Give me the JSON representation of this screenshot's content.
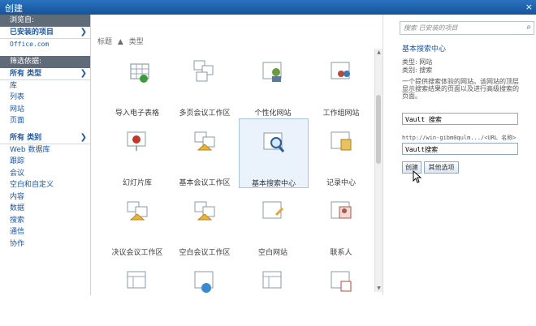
{
  "window": {
    "title": "创建",
    "close_glyph": "×"
  },
  "left": {
    "browse_header": "浏览自:",
    "installed_items": "已安装的项目",
    "office_com": "Office.com",
    "filter_header": "筛选依据:",
    "all_types": "所有 类型",
    "types": [
      "库",
      "列表",
      "网站",
      "页面"
    ],
    "all_categories": "所有 类别",
    "categories": [
      "Web 数据库",
      "跟踪",
      "会议",
      "空白和自定义",
      "内容",
      "数据",
      "搜索",
      "通信",
      "协作"
    ]
  },
  "main": {
    "sort_title": "标题",
    "sort_arrow": "▲",
    "sort_type": "类型",
    "tiles": [
      {
        "label": "导入电子表格",
        "icon": "spreadsheet-import-icon"
      },
      {
        "label": "多页会议工作区",
        "icon": "multipage-meeting-icon"
      },
      {
        "label": "个性化网站",
        "icon": "personal-site-icon"
      },
      {
        "label": "工作组网站",
        "icon": "team-site-icon"
      },
      {
        "label": "幻灯片库",
        "icon": "slide-library-icon"
      },
      {
        "label": "基本会议工作区",
        "icon": "basic-meeting-icon"
      },
      {
        "label": "基本搜索中心",
        "icon": "search-center-icon"
      },
      {
        "label": "记录中心",
        "icon": "records-center-icon"
      },
      {
        "label": "决议会议工作区",
        "icon": "decision-meeting-icon"
      },
      {
        "label": "空白会议工作区",
        "icon": "blank-meeting-icon"
      },
      {
        "label": "空白网站",
        "icon": "blank-site-icon"
      },
      {
        "label": "联系人",
        "icon": "contacts-icon"
      },
      {
        "label": "",
        "icon": "site-template-icon"
      },
      {
        "label": "",
        "icon": "globe-site-icon"
      },
      {
        "label": "",
        "icon": "list-template-icon"
      },
      {
        "label": "",
        "icon": "calendar-icon"
      }
    ],
    "selected_index": 6
  },
  "right": {
    "search_placeholder": "搜索 已安装的项目",
    "item_title": "基本搜索中心",
    "type_line": "类型:  网站",
    "category_line": "类别:  搜索",
    "description": "一个提供搜索体验的网站。该网站的顶层显示搜索结果的页面以及进行高级搜索的页面。",
    "name_value": "Vault 搜索",
    "url_prefix": "http://win-gibm0qulm.../<URL 名称>",
    "url_value": "Vault搜索",
    "create_button": "创建",
    "more_options_button": "其他选项"
  },
  "colors": {
    "titlebar": "#1b5fa8",
    "accent": "#1b57a8",
    "section_header": "#5f6b79",
    "selected_tile": "#eaf2fc"
  }
}
